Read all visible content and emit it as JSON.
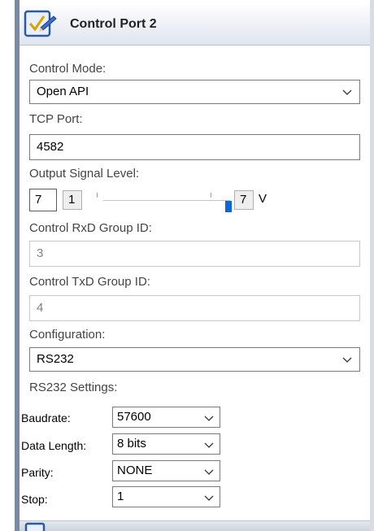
{
  "header": {
    "title": "Control Port 2",
    "icon": "check-pencil-icon"
  },
  "control_mode": {
    "label": "Control Mode:",
    "value": "Open API"
  },
  "tcp_port": {
    "label": "TCP Port:",
    "value": "4582"
  },
  "output_signal": {
    "label": "Output Signal Level:",
    "value": "7",
    "min": "1",
    "max": "7",
    "unit": "V",
    "level_fraction": 1.0
  },
  "rxd_group": {
    "label": "Control RxD Group ID:",
    "value": "3"
  },
  "txd_group": {
    "label": "Control TxD Group ID:",
    "value": "4"
  },
  "configuration": {
    "label": "Configuration:",
    "value": "RS232"
  },
  "rs232": {
    "label": "RS232 Settings:",
    "baudrate": {
      "label": "Baudrate:",
      "value": "57600"
    },
    "data_length": {
      "label": "Data Length:",
      "value": "8 bits"
    },
    "parity": {
      "label": "Parity:",
      "value": "NONE"
    },
    "stop": {
      "label": "Stop:",
      "value": "1"
    }
  },
  "colors": {
    "accent": "#0a67d6",
    "header_gradient_bottom": "#dfe5ee"
  }
}
